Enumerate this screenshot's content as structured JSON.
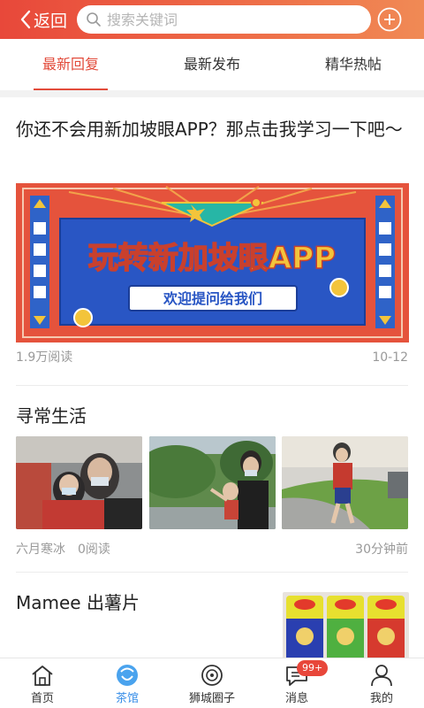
{
  "header": {
    "back_label": "返回",
    "search_placeholder": "搜索关键词"
  },
  "tabs": [
    {
      "label": "最新回复",
      "active": true
    },
    {
      "label": "最新发布",
      "active": false
    },
    {
      "label": "精华热帖",
      "active": false
    }
  ],
  "posts": [
    {
      "title": "你还不会用新加坡眼APP？那点击我学习一下吧～",
      "banner": {
        "headline": "玩转新加坡眼APP",
        "subline": "欢迎提问给我们"
      },
      "views": "1.9万阅读",
      "date": "10-12"
    },
    {
      "title": "寻常生活",
      "author": "六月寒冰",
      "views": "0阅读",
      "time": "30分钟前"
    },
    {
      "title": "Mamee 出薯片"
    }
  ],
  "bottom_nav": [
    {
      "label": "首页",
      "icon": "home-icon",
      "active": false
    },
    {
      "label": "茶馆",
      "icon": "teahouse-icon",
      "active": true
    },
    {
      "label": "狮城圈子",
      "icon": "circle-icon",
      "active": false
    },
    {
      "label": "消息",
      "icon": "message-icon",
      "active": false,
      "badge": "99+"
    },
    {
      "label": "我的",
      "icon": "profile-icon",
      "active": false
    }
  ],
  "colors": {
    "accent": "#e24b3b",
    "nav_active": "#3a8fe8"
  }
}
